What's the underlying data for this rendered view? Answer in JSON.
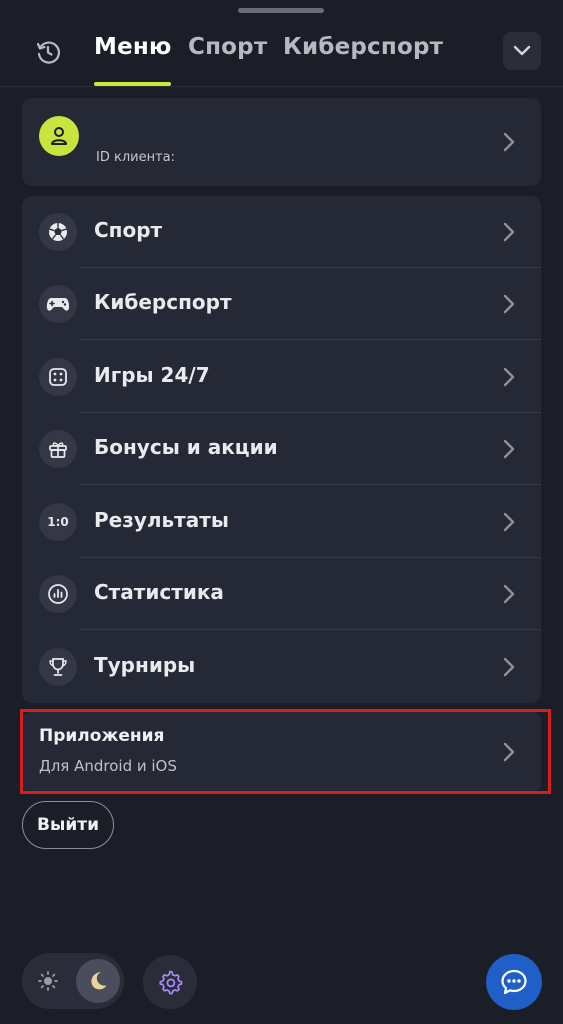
{
  "header": {
    "tabs": [
      {
        "label": "Меню"
      },
      {
        "label": "Спорт"
      },
      {
        "label": "Киберспорт"
      }
    ],
    "history_icon": "clock-icon",
    "collapse_icon": "chevron-down-icon",
    "accent_color": "#c7ec3b"
  },
  "profile": {
    "avatar_icon": "user-icon",
    "client_id_label": "ID клиента:"
  },
  "menu": {
    "items": [
      {
        "label": "Спорт",
        "icon": "soccer-ball-icon"
      },
      {
        "label": "Киберспорт",
        "icon": "gamepad-icon"
      },
      {
        "label": "Игры 24/7",
        "icon": "dice-icon"
      },
      {
        "label": "Бонусы и акции",
        "icon": "gift-icon"
      },
      {
        "label": "Результаты",
        "icon": "score-icon",
        "icon_text": "1:0"
      },
      {
        "label": "Статистика",
        "icon": "statistics-icon"
      },
      {
        "label": "Турниры",
        "icon": "trophy-icon"
      }
    ]
  },
  "apps": {
    "title": "Приложения",
    "subtitle": "Для Android и iOS",
    "highlight_color": "#d81d21"
  },
  "logout": {
    "label": "Выйти"
  },
  "bottom": {
    "theme_light_icon": "sun-icon",
    "theme_dark_icon": "moon-icon",
    "settings_icon": "gear-icon",
    "chat_icon": "chat-icon",
    "chat_color": "#1f5fc7"
  }
}
